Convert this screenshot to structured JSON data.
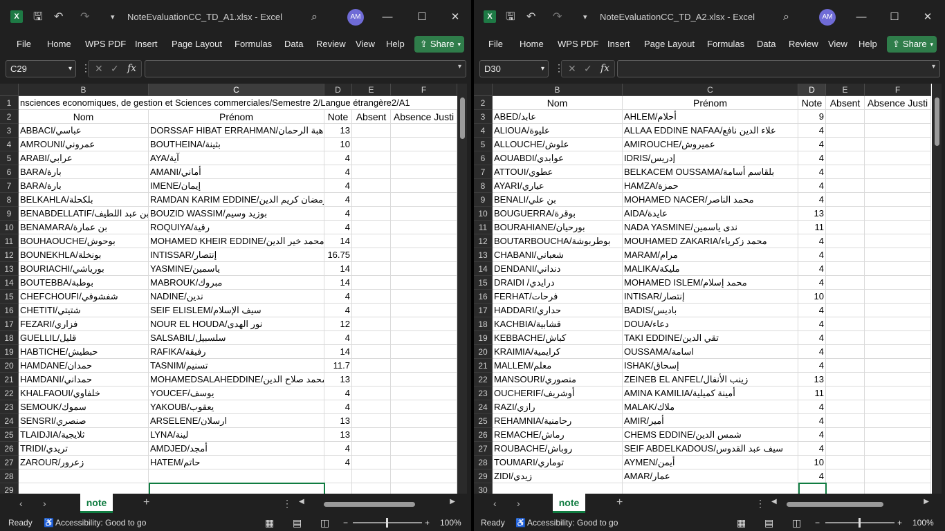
{
  "left": {
    "title": "NoteEvaluationCC_TD_A1.xlsx  -  Excel",
    "user_initials": "AM",
    "menu": [
      "File",
      "Home",
      "WPS PDF",
      "Insert",
      "Page Layout",
      "Formulas",
      "Data",
      "Review",
      "View",
      "Help"
    ],
    "share_label": "Share",
    "namebox": "C29",
    "columns": [
      "B",
      "C",
      "D",
      "E",
      "F"
    ],
    "title_row": {
      "num": "1",
      "text": "nsciences economiques, de gestion et Sciences commerciales/Semestre 2/Langue étrangère2/A1"
    },
    "header_row": {
      "num": "2",
      "cells": [
        "Nom",
        "Prénom",
        "Note",
        "Absent",
        "Absence Justi"
      ]
    },
    "rows": [
      {
        "num": "3",
        "nom": "ABBACI/عباسي",
        "prenom": "DORSSAF HIBAT ERRAHMAN/درصاف هبة الرحمان",
        "note": "13"
      },
      {
        "num": "4",
        "nom": "AMROUNI/عمروني",
        "prenom": "BOUTHEINA/بثينة",
        "note": "10"
      },
      {
        "num": "5",
        "nom": "ARABI/عرابي",
        "prenom": "AYA/آية",
        "note": "4"
      },
      {
        "num": "6",
        "nom": "BARA/بارة",
        "prenom": "AMANI/أماني",
        "note": "4"
      },
      {
        "num": "7",
        "nom": "BARA/بارة",
        "prenom": "IMENE/إيمان",
        "note": "4"
      },
      {
        "num": "8",
        "nom": "BELKAHLA/بلكحلة",
        "prenom": "RAMDAN KARIM EDDINE/رمضان كريم الدين",
        "note": "4"
      },
      {
        "num": "9",
        "nom": "BENABDELLATIF/بن عبد اللطيف",
        "prenom": "BOUZID WASSIM/بوزيد وسيم",
        "note": "4"
      },
      {
        "num": "10",
        "nom": "BENAMARA/بن عمارة",
        "prenom": "ROQUIYA/رقية",
        "note": "4"
      },
      {
        "num": "11",
        "nom": "BOUHAOUCHE/بوحوش",
        "prenom": "MOHAMED KHEIR EDDINE/محمد خير الدين",
        "note": "14"
      },
      {
        "num": "12",
        "nom": "BOUNEKHLA/بونخلة",
        "prenom": "INTISSAR/إنتصار",
        "note": "16.75"
      },
      {
        "num": "13",
        "nom": "BOURIACHI/بورياشي",
        "prenom": "YASMINE/ياسمين",
        "note": "14"
      },
      {
        "num": "14",
        "nom": "BOUTEBBA/بوطبة",
        "prenom": "MABROUK/مبروك",
        "note": "14"
      },
      {
        "num": "15",
        "nom": "CHEFCHOUFI/شفشوفي",
        "prenom": "NADINE/ندين",
        "note": "4"
      },
      {
        "num": "16",
        "nom": "CHETITI/شتيتي",
        "prenom": "SEIF ELISLEM/سيف الإسلام",
        "note": "4"
      },
      {
        "num": "17",
        "nom": "FEZARI/فزاري",
        "prenom": "NOUR EL HOUDA/نور الهدى",
        "note": "12"
      },
      {
        "num": "18",
        "nom": "GUELLIL/قليل",
        "prenom": "SALSABIL/سلسبيل",
        "note": "4"
      },
      {
        "num": "19",
        "nom": "HABTICHE/حبطيش",
        "prenom": "RAFIKA/رفيقة",
        "note": "14"
      },
      {
        "num": "20",
        "nom": "HAMDANE/حمدان",
        "prenom": "TASNIM/تسنيم",
        "note": "11.7"
      },
      {
        "num": "21",
        "nom": "HAMDANI/حمداني",
        "prenom": "MOHAMEDSALAHEDDINE/محمد صلاح الدين",
        "note": "13"
      },
      {
        "num": "22",
        "nom": "KHALFAOUI/خلفاوي",
        "prenom": "YOUCEF/يوسف",
        "note": "4"
      },
      {
        "num": "23",
        "nom": "SEMOUK/سموك",
        "prenom": "YAKOUB/يعقوب",
        "note": "4"
      },
      {
        "num": "24",
        "nom": "SENSRI/صنصري",
        "prenom": "ARSELENE/ارسلان",
        "note": "13"
      },
      {
        "num": "25",
        "nom": "TLAIDJIA/ثلايجية",
        "prenom": "LYNA/لينة",
        "note": "13"
      },
      {
        "num": "26",
        "nom": "TRIDI/تريدي",
        "prenom": "AMDJED/أمجد",
        "note": "4"
      },
      {
        "num": "27",
        "nom": "ZAROUR/زعرور",
        "prenom": "HATEM/حاتم",
        "note": "4"
      },
      {
        "num": "28",
        "nom": "",
        "prenom": "",
        "note": ""
      },
      {
        "num": "29",
        "nom": "",
        "prenom": "",
        "note": ""
      }
    ],
    "sheet_tab": "note",
    "status": {
      "ready": "Ready",
      "accessibility": "Accessibility: Good to go",
      "zoom": "100%"
    }
  },
  "right": {
    "title": "NoteEvaluationCC_TD_A2.xlsx  -  Excel",
    "user_initials": "AM",
    "menu": [
      "File",
      "Home",
      "WPS PDF",
      "Insert",
      "Page Layout",
      "Formulas",
      "Data",
      "Review",
      "View",
      "Help"
    ],
    "share_label": "Share",
    "namebox": "D30",
    "columns": [
      "B",
      "C",
      "D",
      "E",
      "F"
    ],
    "header_row": {
      "num": "2",
      "cells": [
        "Nom",
        "Prénom",
        "Note",
        "Absent",
        "Absence Justi"
      ]
    },
    "rows": [
      {
        "num": "3",
        "nom": "ABED/عابد",
        "prenom": "AHLEM/أحلام",
        "note": "9"
      },
      {
        "num": "4",
        "nom": "ALIOUA/عليوة",
        "prenom": "ALLAA EDDINE NAFAA/علاء الدين نافع",
        "note": "4"
      },
      {
        "num": "5",
        "nom": "ALLOUCHE/علوش",
        "prenom": "AMIROUCHE/عميروش",
        "note": "4"
      },
      {
        "num": "6",
        "nom": "AOUABDI/عوابدي",
        "prenom": "IDRIS/إدريس",
        "note": "4"
      },
      {
        "num": "7",
        "nom": "ATTOUI/عطوي",
        "prenom": "BELKACEM OUSSAMA/بلقاسم أسامة",
        "note": "4"
      },
      {
        "num": "8",
        "nom": "AYARI/عياري",
        "prenom": "HAMZA/حمزة",
        "note": "4"
      },
      {
        "num": "9",
        "nom": "BENALI/بن علي",
        "prenom": "MOHAMED NACER/محمد الناصر",
        "note": "4"
      },
      {
        "num": "10",
        "nom": "BOUGUERRA/بوقرة",
        "prenom": "AIDA/عايدة",
        "note": "13"
      },
      {
        "num": "11",
        "nom": "BOURAHIANE/بورحيان",
        "prenom": "NADA YASMINE/ندى ياسمين",
        "note": "11"
      },
      {
        "num": "12",
        "nom": "BOUTARBOUCHA/بوطربوشة",
        "prenom": "MOUHAMED ZAKARIA/محمد زكرياء",
        "note": "4"
      },
      {
        "num": "13",
        "nom": "CHABANI/شعباني",
        "prenom": "MARAM/مرام",
        "note": "4"
      },
      {
        "num": "14",
        "nom": "DENDANI/دنداني",
        "prenom": "MALIKA/مليكة",
        "note": "4"
      },
      {
        "num": "15",
        "nom": "DRAIDI /درايدي",
        "prenom": "MOHAMED ISLEM/محمد إسلام",
        "note": "4"
      },
      {
        "num": "16",
        "nom": "FERHAT/فرحات",
        "prenom": "INTISAR/إنتصار",
        "note": "10"
      },
      {
        "num": "17",
        "nom": "HADDARI/حداري",
        "prenom": "BADIS/باديس",
        "note": "4"
      },
      {
        "num": "18",
        "nom": "KACHBIA/قشابية",
        "prenom": "DOUA/دعاء",
        "note": "4"
      },
      {
        "num": "19",
        "nom": "KEBBACHE/كباش",
        "prenom": "TAKI EDDINE/تقي الدين",
        "note": "4"
      },
      {
        "num": "20",
        "nom": "KRAIMIA/كرايمية",
        "prenom": "OUSSAMA/اسامة",
        "note": "4"
      },
      {
        "num": "21",
        "nom": "MALLEM/معلم",
        "prenom": "ISHAK/إسحاق",
        "note": "4"
      },
      {
        "num": "22",
        "nom": "MANSOURI/منصوري",
        "prenom": "ZEINEB EL ANFEL/زينب الأنفال",
        "note": "13"
      },
      {
        "num": "23",
        "nom": "OUCHERIF/أوشريف",
        "prenom": "AMINA KAMILIA/أمينة كميلية",
        "note": "11"
      },
      {
        "num": "24",
        "nom": "RAZI/رازي",
        "prenom": "MALAK/ملاك",
        "note": "4"
      },
      {
        "num": "25",
        "nom": "REHAMNIA/رحامنية",
        "prenom": "AMIR/أمير",
        "note": "4"
      },
      {
        "num": "26",
        "nom": "REMACHE/رماش",
        "prenom": "CHEMS EDDINE/شمس الدين",
        "note": "4"
      },
      {
        "num": "27",
        "nom": "ROUBACHE/روباش",
        "prenom": "SEIF ABDELKADOUS/سيف عبد القدوس",
        "note": "4"
      },
      {
        "num": "28",
        "nom": "TOUMARI/توماري",
        "prenom": "AYMEN/أيمن",
        "note": "10"
      },
      {
        "num": "29",
        "nom": "ZIDI/زيدي",
        "prenom": "AMAR/عمار",
        "note": "4"
      },
      {
        "num": "30",
        "nom": "",
        "prenom": "",
        "note": ""
      }
    ],
    "sheet_tab": "note",
    "status": {
      "ready": "Ready",
      "accessibility": "Accessibility: Good to go",
      "zoom": "100%"
    }
  }
}
